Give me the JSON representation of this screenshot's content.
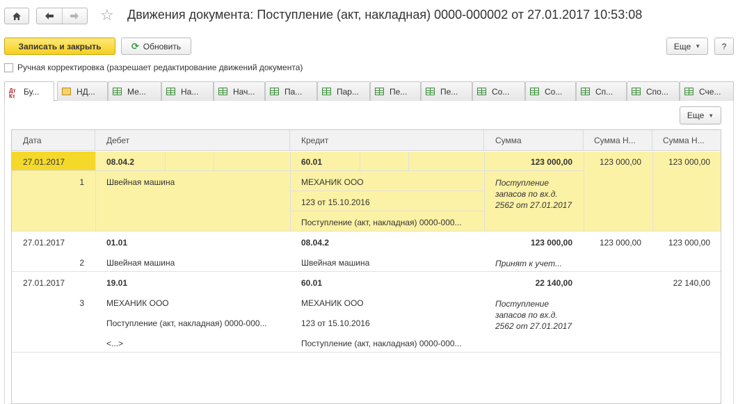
{
  "window": {
    "title": "Движения документа: Поступление (акт, накладная) 0000-000002 от 27.01.2017 10:53:08",
    "home_icon": "home-icon",
    "back_icon": "arrow-left-icon",
    "forward_icon": "arrow-right-icon",
    "favorite_icon": "star-icon"
  },
  "toolbar": {
    "save_close": "Записать и закрыть",
    "refresh": "Обновить",
    "more": "Еще",
    "help": "?"
  },
  "manual_edit": {
    "label": "Ручная корректировка (разрешает редактирование движений документа)",
    "checked": false
  },
  "tabs": [
    {
      "label": "Бу...",
      "icon": "dtkt-icon",
      "active": true
    },
    {
      "label": "НД...",
      "icon": "vat-icon"
    },
    {
      "label": "Ме...",
      "icon": "grid-icon"
    },
    {
      "label": "На...",
      "icon": "grid-icon"
    },
    {
      "label": "Нач...",
      "icon": "grid-icon"
    },
    {
      "label": "Па...",
      "icon": "grid-icon"
    },
    {
      "label": "Пар...",
      "icon": "grid-icon"
    },
    {
      "label": "Пе...",
      "icon": "grid-icon"
    },
    {
      "label": "Пе...",
      "icon": "grid-icon"
    },
    {
      "label": "Со...",
      "icon": "grid-icon"
    },
    {
      "label": "Со...",
      "icon": "grid-icon"
    },
    {
      "label": "Сп...",
      "icon": "grid-icon"
    },
    {
      "label": "Спо...",
      "icon": "grid-icon"
    },
    {
      "label": "Сче...",
      "icon": "grid-icon"
    }
  ],
  "grid": {
    "more": "Еще",
    "columns": [
      "Дата",
      "Дебет",
      "Кредит",
      "Сумма",
      "Сумма Н...",
      "Сумма Н..."
    ],
    "rows": [
      {
        "date": "27.01.2017",
        "num": "1",
        "debit": "08.04.2",
        "debit_sub": [
          "Швейная машина"
        ],
        "credit": "60.01",
        "credit_sub": [
          "МЕХАНИК ООО",
          "123 от 15.10.2016",
          "Поступление (акт, накладная) 0000-000..."
        ],
        "sum": "123 000,00",
        "content": "Поступление запасов по вх.д. 2562 от 27.01.2017",
        "sum_n1": "123 000,00",
        "sum_n2": "123 000,00"
      },
      {
        "date": "27.01.2017",
        "num": "2",
        "debit": "01.01",
        "debit_sub": [
          "Швейная машина"
        ],
        "credit": "08.04.2",
        "credit_sub": [
          "Швейная машина"
        ],
        "sum": "123 000,00",
        "content": "Принят к учет...",
        "sum_n1": "123 000,00",
        "sum_n2": "123 000,00"
      },
      {
        "date": "27.01.2017",
        "num": "3",
        "debit": "19.01",
        "debit_sub": [
          "МЕХАНИК ООО",
          "Поступление (акт, накладная) 0000-000...",
          "<...>"
        ],
        "credit": "60.01",
        "credit_sub": [
          "МЕХАНИК ООО",
          "123 от 15.10.2016",
          "Поступление (акт, накладная) 0000-000..."
        ],
        "sum": "22 140,00",
        "content": "Поступление запасов по вх.д. 2562 от 27.01.2017",
        "sum_n1": "",
        "sum_n2": "22 140,00"
      }
    ]
  }
}
